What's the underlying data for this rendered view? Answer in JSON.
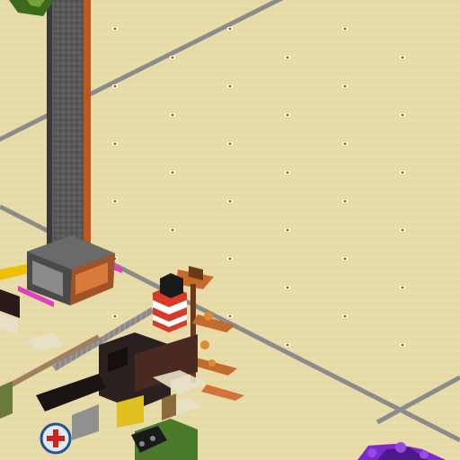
{
  "scene": {
    "view": "isometric",
    "ground": {
      "material": "sand",
      "color": "#e8dcaa",
      "marker_color": "#8a3a2a",
      "marker_light_color": "#f6f0dc"
    },
    "structures": [
      {
        "name": "tall-chimney-tower",
        "colors": [
          "#5a5a5a",
          "#c0551e",
          "#3a3a3a"
        ]
      },
      {
        "name": "rail-track-diagonal",
        "colors": [
          "#8b8b8b"
        ]
      },
      {
        "name": "copper-pipe-platform",
        "colors": [
          "#c46a2a",
          "#6b3a1a"
        ]
      },
      {
        "name": "red-white-silo",
        "colors": [
          "#d83a2a",
          "#ffffff"
        ]
      },
      {
        "name": "dark-cannon-machine",
        "colors": [
          "#2a2020",
          "#4a2a20"
        ]
      },
      {
        "name": "first-aid-sign",
        "colors": [
          "#e0e8f0",
          "#d02020",
          "#2050a0"
        ]
      },
      {
        "name": "green-block-machine",
        "colors": [
          "#4a7a2a",
          "#1a1a1a"
        ]
      },
      {
        "name": "purple-crystal-cluster",
        "colors": [
          "#7a2ad0",
          "#4a1a8a"
        ]
      },
      {
        "name": "magenta-conveyor-edge",
        "colors": [
          "#e040c0"
        ]
      },
      {
        "name": "yellow-rail-edge",
        "colors": [
          "#f0c000"
        ]
      }
    ]
  }
}
